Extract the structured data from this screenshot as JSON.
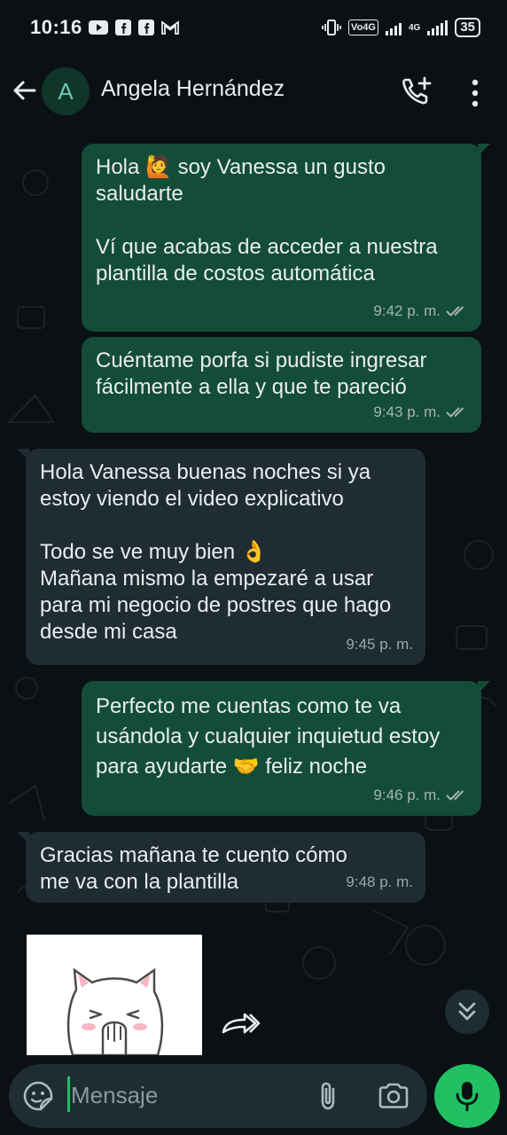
{
  "status_bar": {
    "time": "10:16",
    "volte": "Vo4G",
    "network": "4G",
    "battery": "35"
  },
  "header": {
    "avatar_initial": "A",
    "contact_name": "Angela Hernández"
  },
  "messages": [
    {
      "direction": "outgoing",
      "paragraphs": [
        "Hola 🙋 soy Vanessa un gusto saludarte",
        "Ví que acabas de acceder a nuestra plantilla de costos automática"
      ],
      "time": "9:42 p. m.",
      "read": true
    },
    {
      "direction": "outgoing",
      "paragraphs": [
        "Cuéntame porfa si pudiste ingresar fácilmente a ella y que te pareció"
      ],
      "time": "9:43 p. m.",
      "read": true
    },
    {
      "direction": "incoming",
      "paragraphs": [
        "Hola Vanessa buenas noches si ya estoy viendo el video explicativo",
        "Todo se ve muy bien 👌\nMañana mismo la empezaré a usar para mi negocio de postres que hago desde mi casa"
      ],
      "time": "9:45 p. m."
    },
    {
      "direction": "outgoing",
      "paragraphs": [
        "Perfecto me cuentas como te va usándola y cualquier inquietud estoy para ayudarte 🤝 feliz noche"
      ],
      "time": "9:46 p. m.",
      "read": true
    },
    {
      "direction": "incoming",
      "paragraphs": [
        "Gracias mañana te cuento cómo me va con la plantilla"
      ],
      "time": "9:48 p. m."
    }
  ],
  "input": {
    "placeholder": "Mensaje"
  },
  "colors": {
    "outgoing_bubble": "#144d37",
    "incoming_bubble": "#1f2c33",
    "accent": "#21c063",
    "background": "#0b1014"
  },
  "icons": [
    "back-arrow-icon",
    "add-call-icon",
    "more-options-icon",
    "double-check-icon",
    "forward-icon",
    "scroll-down-icon",
    "sticker-emoji-icon",
    "attach-clip-icon",
    "camera-icon",
    "microphone-icon"
  ]
}
